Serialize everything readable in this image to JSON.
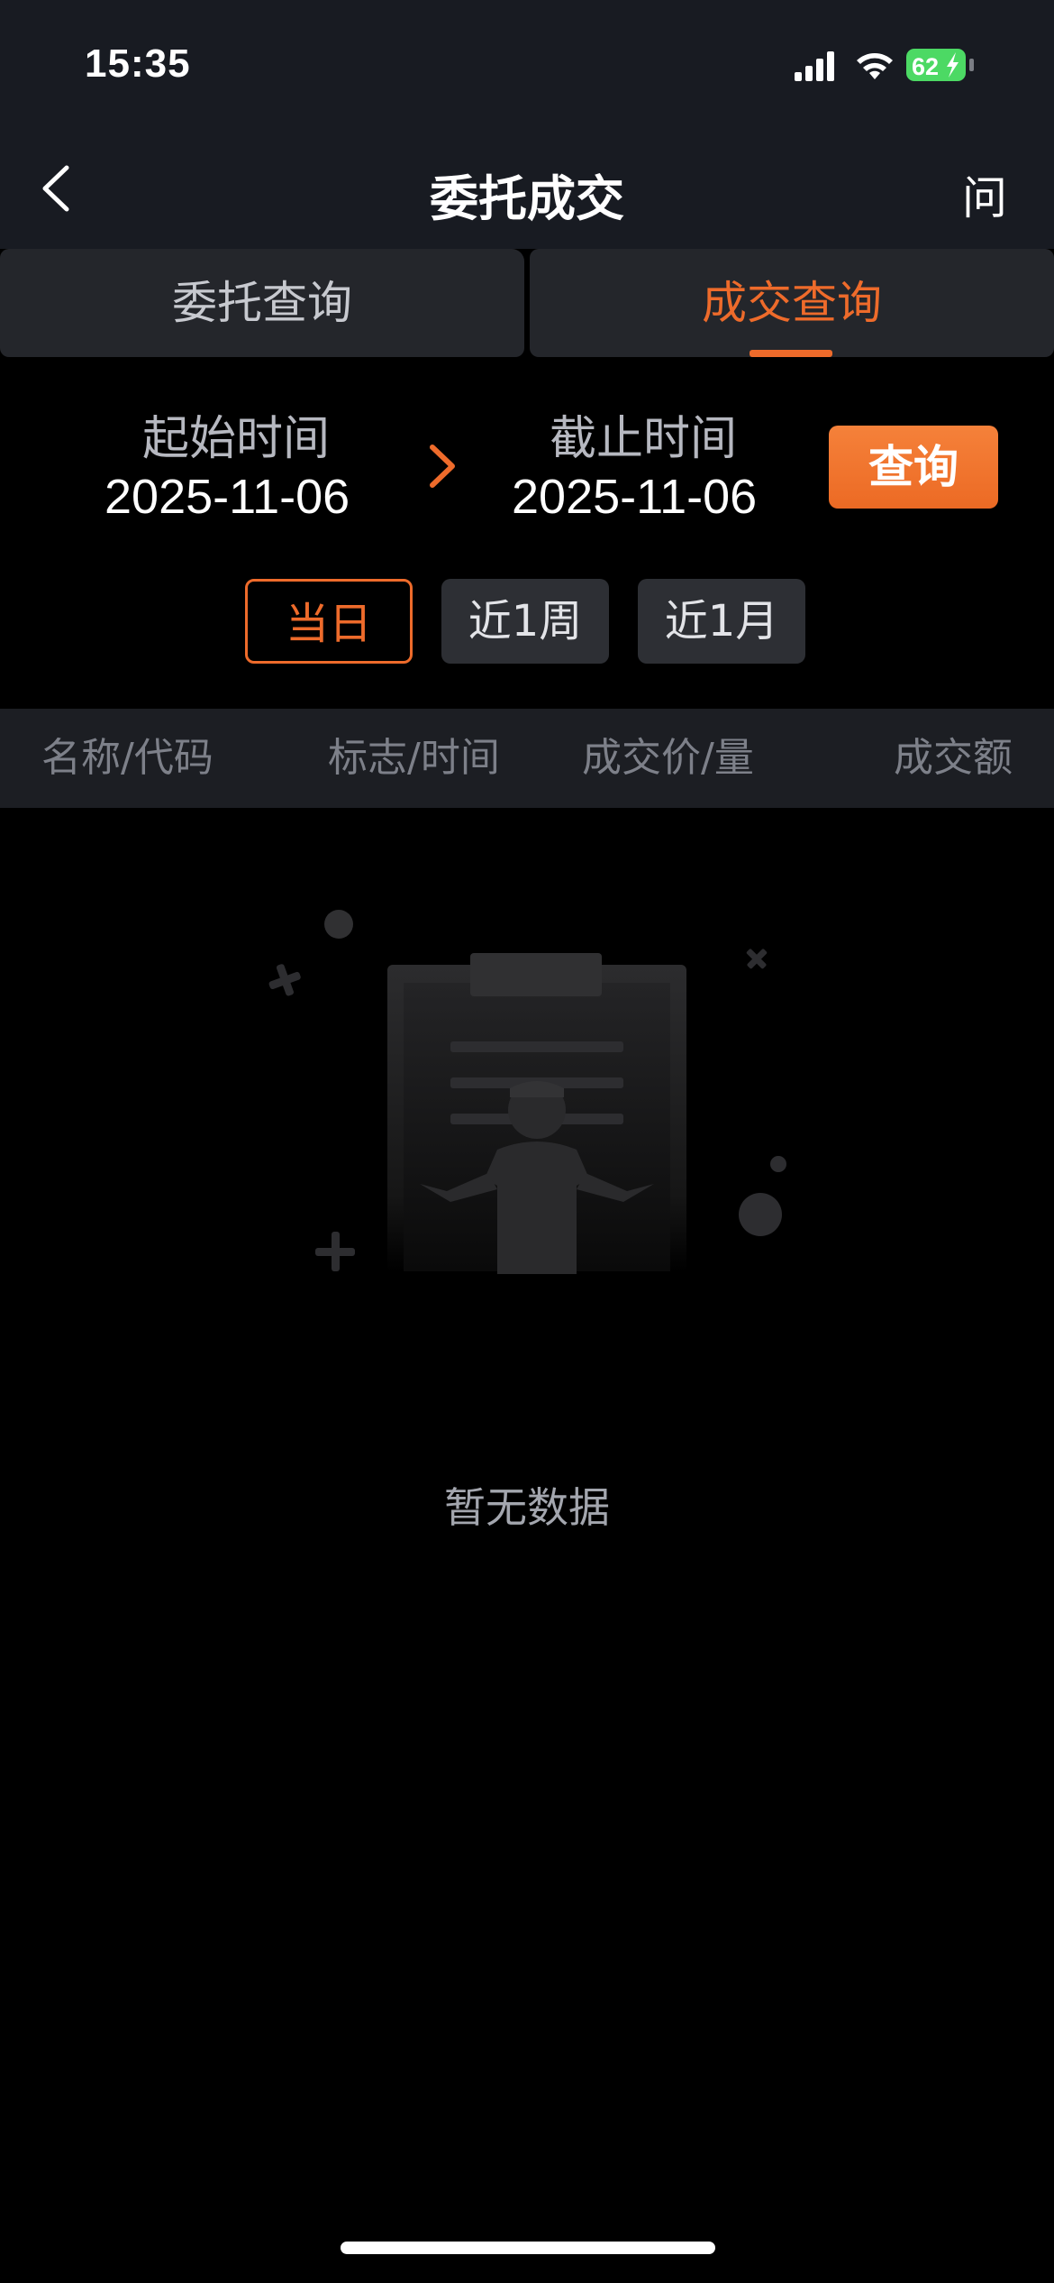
{
  "status_bar": {
    "time": "15:35",
    "battery": "62",
    "icons": [
      "signal-icon",
      "wifi-icon",
      "battery-charging-icon"
    ]
  },
  "nav": {
    "title": "委托成交",
    "help_label": "问",
    "back_icon": "chevron-left-icon"
  },
  "tabs": [
    {
      "label": "委托查询",
      "active": false
    },
    {
      "label": "成交查询",
      "active": true
    }
  ],
  "date_range": {
    "start_label": "起始时间",
    "start_value": "2025-11-06",
    "end_label": "截止时间",
    "end_value": "2025-11-06",
    "arrow_icon": "chevron-right-icon",
    "query_label": "查询"
  },
  "quick_filters": [
    {
      "label": "当日",
      "active": true
    },
    {
      "label": "近1周",
      "active": false
    },
    {
      "label": "近1月",
      "active": false
    }
  ],
  "table": {
    "headers": [
      "名称/代码",
      "标志/时间",
      "成交价/量",
      "成交额"
    ]
  },
  "empty_state": {
    "icon": "empty-clipboard-icon",
    "text": "暂无数据"
  },
  "colors": {
    "accent": "#ee6b2b",
    "background": "#000000",
    "nav_background": "#181b22",
    "battery_green": "#4cd964"
  }
}
